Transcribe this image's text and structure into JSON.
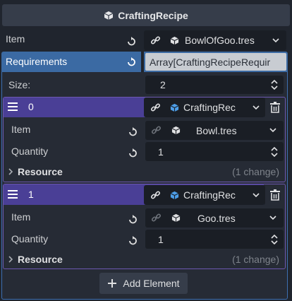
{
  "header": {
    "title": "CraftingRecipe",
    "icon": "cube-icon"
  },
  "item": {
    "label": "Item",
    "value": "BowlOfGoo.tres"
  },
  "requirements": {
    "label": "Requirements",
    "value": "Array[CraftingRecipeRequir",
    "size_label": "Size:",
    "size_value": "2",
    "elements": [
      {
        "index": "0",
        "type_name": "CraftingRec",
        "item_label": "Item",
        "item_value": "Bowl.tres",
        "quantity_label": "Quantity",
        "quantity_value": "1",
        "resource_label": "Resource",
        "resource_changes": "(1 change)"
      },
      {
        "index": "1",
        "type_name": "CraftingRec",
        "item_label": "Item",
        "item_value": "Goo.tres",
        "quantity_label": "Quantity",
        "quantity_value": "1",
        "resource_label": "Resource",
        "resource_changes": "(1 change)"
      }
    ],
    "add_element_label": "Add Element"
  },
  "colors": {
    "background": "#20252e",
    "accent_blue": "#3b6aa3",
    "accent_purple": "#4a3f96",
    "field_bg": "#1a1e25",
    "resource_icon_blue": "#4d9ee8"
  }
}
